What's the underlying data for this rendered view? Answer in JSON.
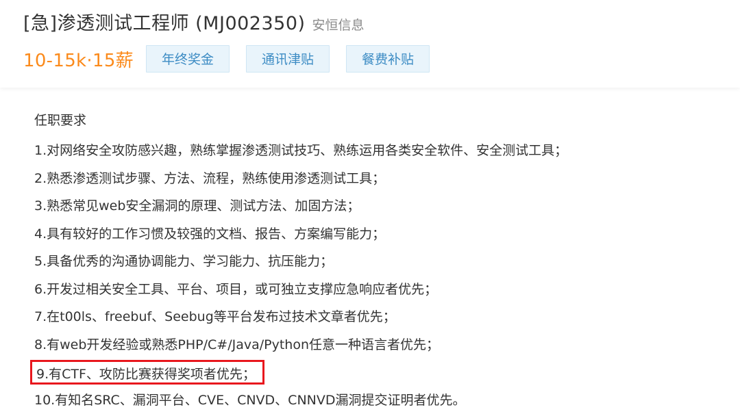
{
  "header": {
    "job_title": "[急]渗透测试工程师 (MJ002350)",
    "company": "安恒信息",
    "salary": "10-15k·15薪",
    "benefits": [
      "年终奖金",
      "通讯津贴",
      "餐费补贴"
    ]
  },
  "requirements": {
    "heading": "任职要求",
    "items": [
      "1.对网络安全攻防感兴趣，熟练掌握渗透测试技巧、熟练运用各类安全软件、安全测试工具；",
      "2.熟悉渗透测试步骤、方法、流程，熟练使用渗透测试工具；",
      "3.熟悉常见web安全漏洞的原理、测试方法、加固方法；",
      "4.具有较好的工作习惯及较强的文档、报告、方案编写能力；",
      "5.具备优秀的沟通协调能力、学习能力、抗压能力；",
      "6.开发过相关安全工具、平台、项目，或可独立支撑应急响应者优先；",
      "7.在t00ls、freebuf、Seebug等平台发布过技术文章者优先；",
      "8.有web开发经验或熟悉PHP/C#/Java/Python任意一种语言者优先；",
      "9.有CTF、攻防比赛获得奖项者优先；",
      "10.有知名SRC、漏洞平台、CVE、CNVD、CNNVD漏洞提交证明者优先。"
    ],
    "highlighted_index": 8
  },
  "colors": {
    "salary": "#fb8a1b",
    "tag_text": "#3d8cc4",
    "tag_bg": "#e9f4fb",
    "highlight_border": "#e8171d",
    "text": "#333333",
    "muted": "#8a8a8a"
  }
}
